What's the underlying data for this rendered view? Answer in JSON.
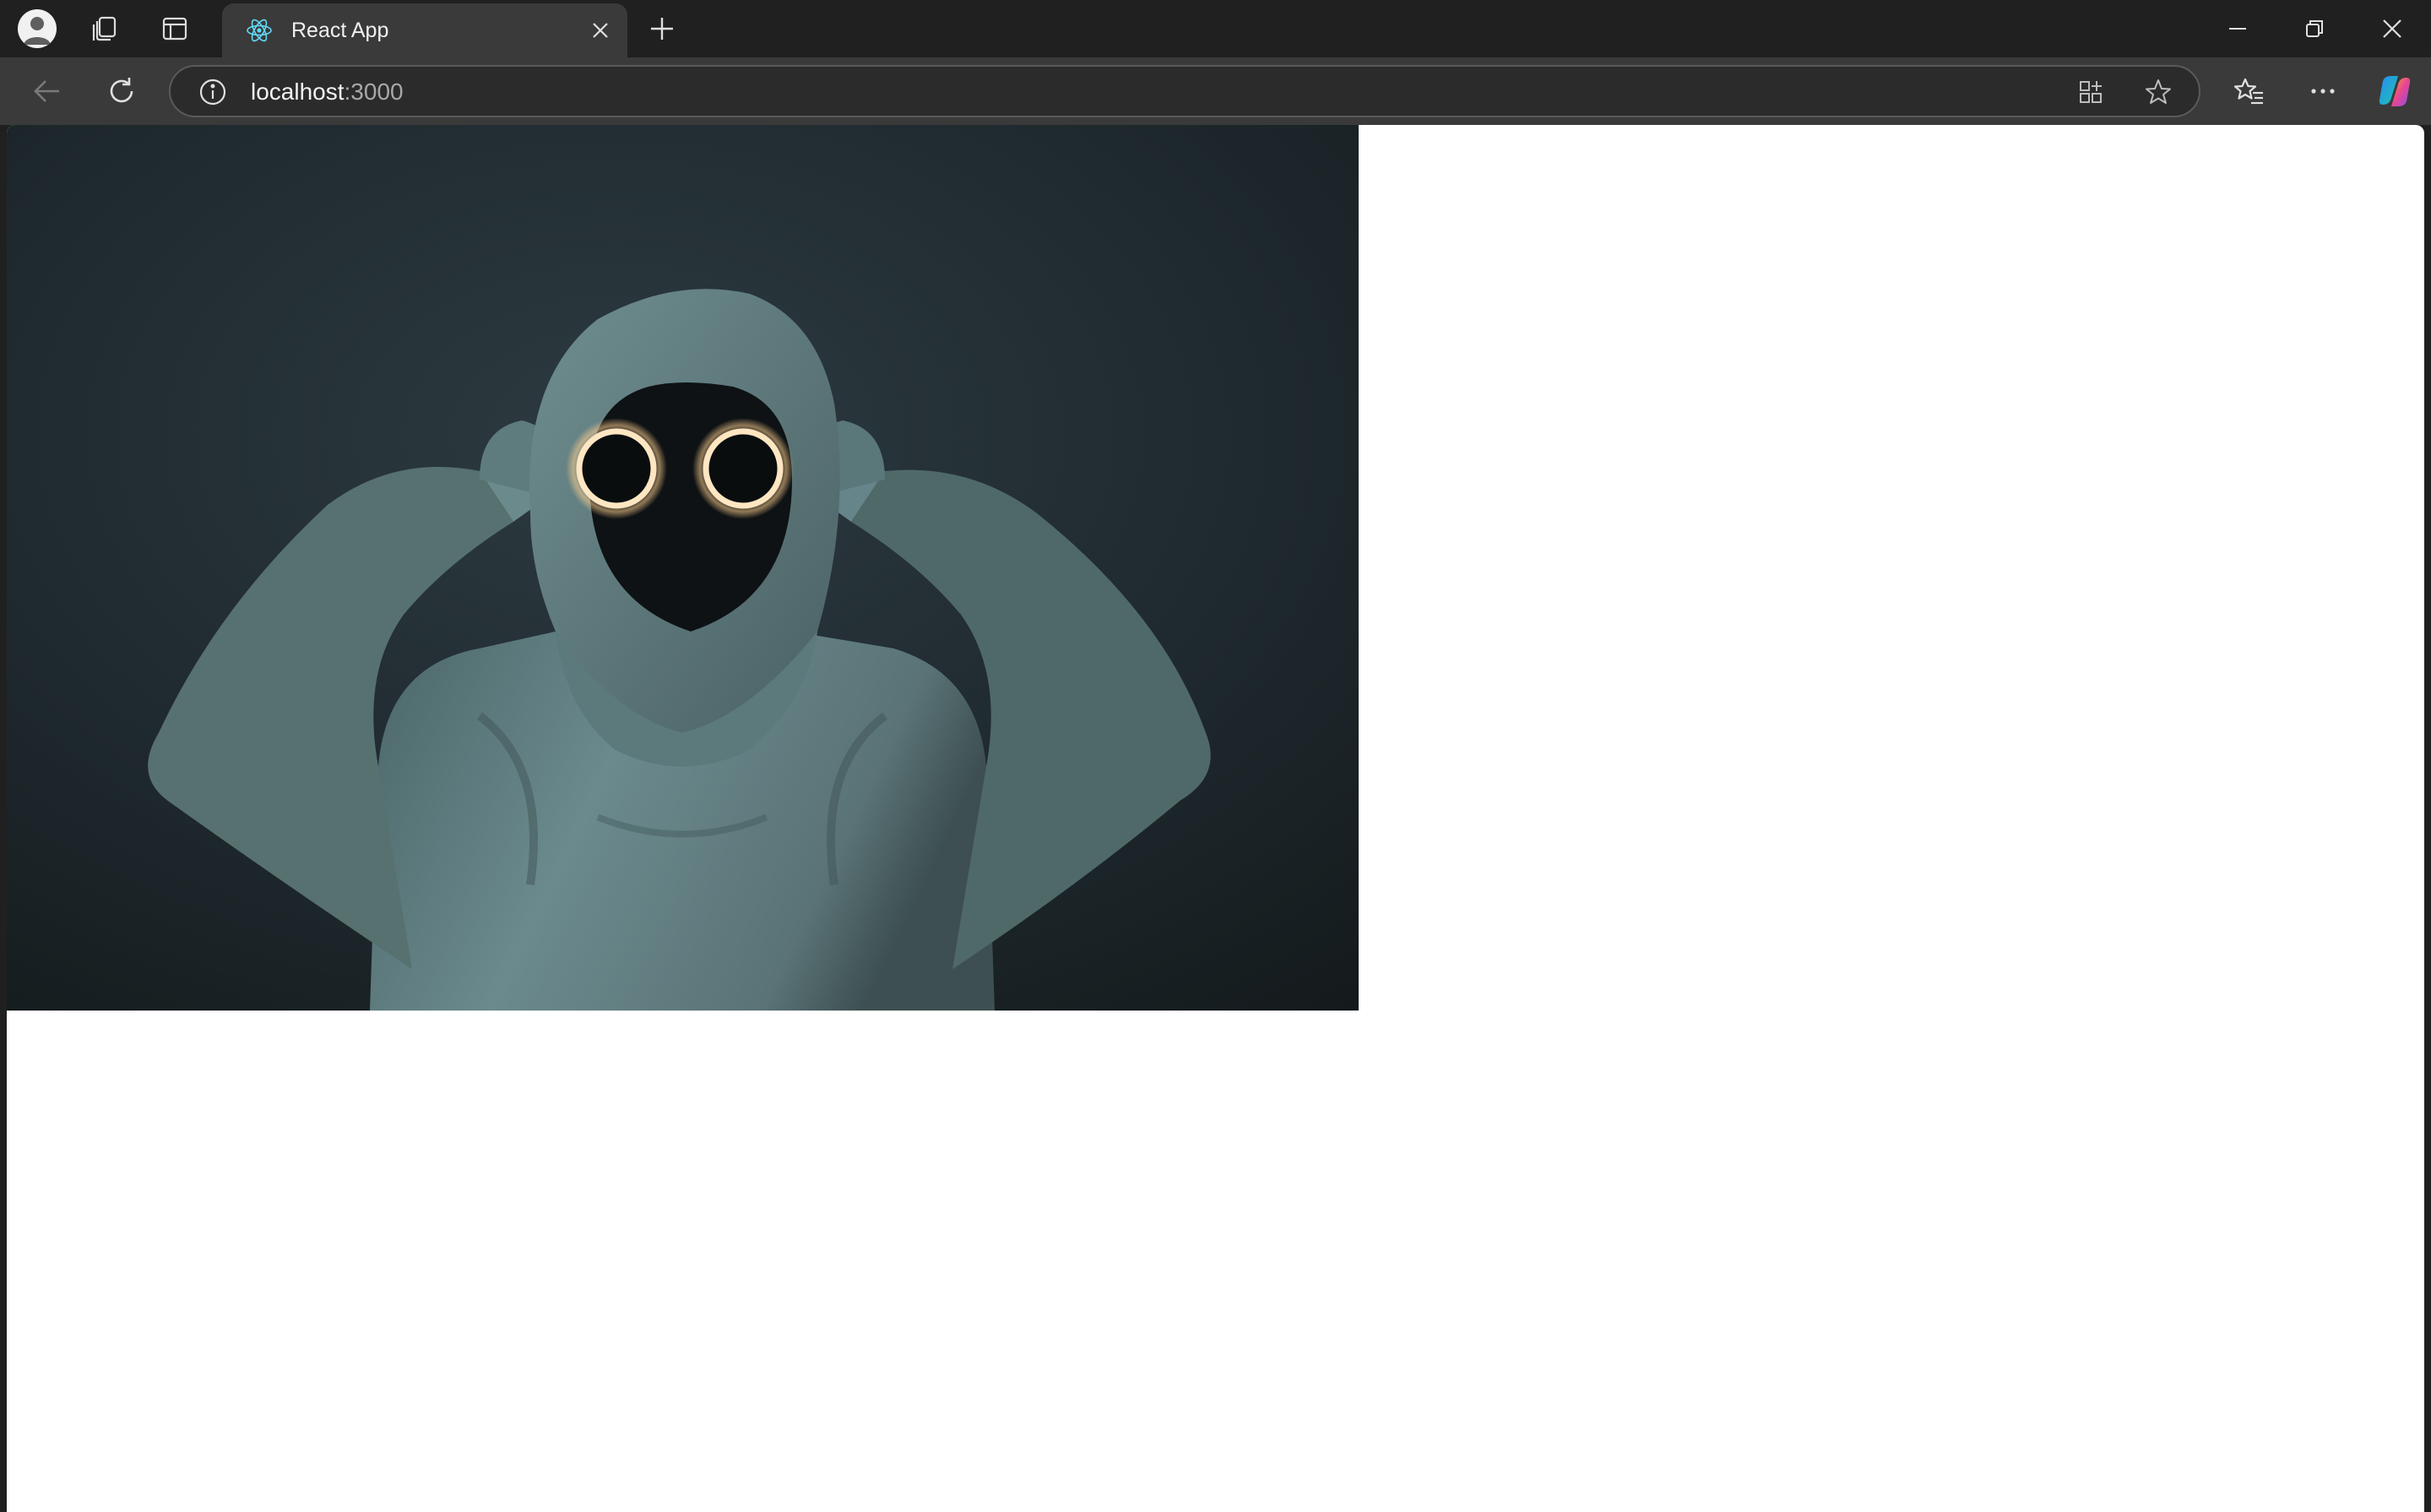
{
  "browser": {
    "tab": {
      "title": "React App",
      "favicon": "react-logo-icon"
    },
    "address_bar": {
      "host": "localhost",
      "port": ":3000",
      "info_icon": "info-icon"
    },
    "toolbar_icons": [
      "back-arrow-icon",
      "refresh-icon",
      "app-available-icon",
      "star-icon",
      "favorites-icon",
      "more-icon",
      "copilot-icon"
    ],
    "tabstrip_icons": [
      "profile-icon",
      "workspaces-icon",
      "tab-actions-icon",
      "new-tab-icon"
    ],
    "window_controls": [
      "minimize-icon",
      "restore-icon",
      "close-icon"
    ]
  },
  "page": {
    "image": {
      "subject": "hooded figure with glowing ring eyes"
    }
  },
  "colors": {
    "chrome_dark": "#202020",
    "toolbar": "#3a3a3a",
    "page_background": "#ffffff",
    "photo_background": "#1f2b30",
    "hoodie": "#5e7c80",
    "eye_glow": "#ffd9a8"
  }
}
